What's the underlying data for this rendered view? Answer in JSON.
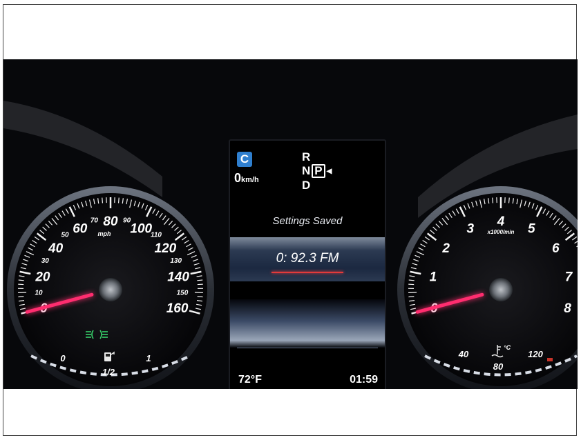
{
  "speedometer": {
    "major_labels": [
      "0",
      "20",
      "40",
      "60",
      "80",
      "100",
      "120",
      "140",
      "160"
    ],
    "minor_labels": [
      "10",
      "30",
      "50",
      "70",
      "90",
      "110",
      "130",
      "150"
    ],
    "unit": "mph",
    "fuel": {
      "empty": "0",
      "half": "1/2",
      "full": "1"
    },
    "needle_value_mph": 0
  },
  "tachometer": {
    "labels": [
      "0",
      "1",
      "2",
      "3",
      "4",
      "5",
      "6",
      "7",
      "8"
    ],
    "unit": "x1000/min",
    "coolant": {
      "low": "40",
      "mid": "80",
      "high": "120",
      "unit": "°C"
    },
    "needle_value_rpm": 0
  },
  "center_display": {
    "drive_mode": "C",
    "speed_value": "0",
    "speed_unit": "km/h",
    "gears": {
      "top": "R",
      "mid_left": "N",
      "selected": "P",
      "bottom": "D"
    },
    "message": "Settings Saved",
    "radio_station": "0: 92.3 FM",
    "outside_temp": "72°F",
    "time": "01:59"
  },
  "colors": {
    "needle": "#ff2d6f",
    "accent_blue": "#2f7fcf",
    "indicator_green": "#37d06a",
    "underline_red": "#e23a3a"
  },
  "icons": [
    "headlight-indicator-icon",
    "fuel-pump-icon",
    "coolant-temperature-icon"
  ]
}
